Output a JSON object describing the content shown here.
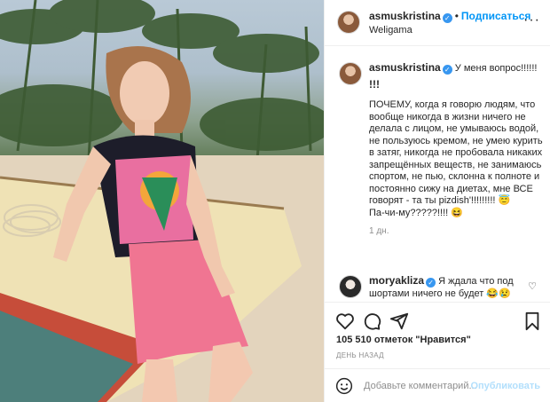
{
  "post": {
    "username": "asmuskristina",
    "location": "Weligama",
    "follow_label": "Подписаться",
    "separator": "•"
  },
  "caption": {
    "username": "asmuskristina",
    "first_line": "У меня вопрос!!!!!!",
    "exclaim": "!!!",
    "text": "ПОЧЕМУ, когда я говорю людям, что вообще никогда в жизни ничего не делала с лицом, не умываюсь водой, не пользуюсь кремом, не умею курить в затяг, никогда не пробовала никаких запрещённых веществ, не занимаюсь спортом, не пью, склонна к полноте и постоянно сижу на диетах, мне ВСЕ говорят - та ты pizdish'!!!!!!!!! 😇\nПа-чи-му?????!!!! 😆",
    "time": "1 дн."
  },
  "comment": {
    "username": "moryakliza",
    "text": "Я ждала что под шортами ничего не будет 😂😢"
  },
  "stats": {
    "likes": "105 510 отметок \"Нравится\"",
    "ago": "ДЕНЬ НАЗАД"
  },
  "add_comment": {
    "placeholder": "Добавьте комментарий...",
    "publish_label": "Опубликовать"
  },
  "icons": {
    "more": "more-options-icon",
    "like": "heart-icon",
    "comment": "comment-icon",
    "share": "share-icon",
    "save": "bookmark-icon",
    "emoji": "emoji-icon"
  },
  "colors": {
    "accent": "#0095f6",
    "verified": "#3897f0",
    "muted": "#8e8e8e"
  }
}
